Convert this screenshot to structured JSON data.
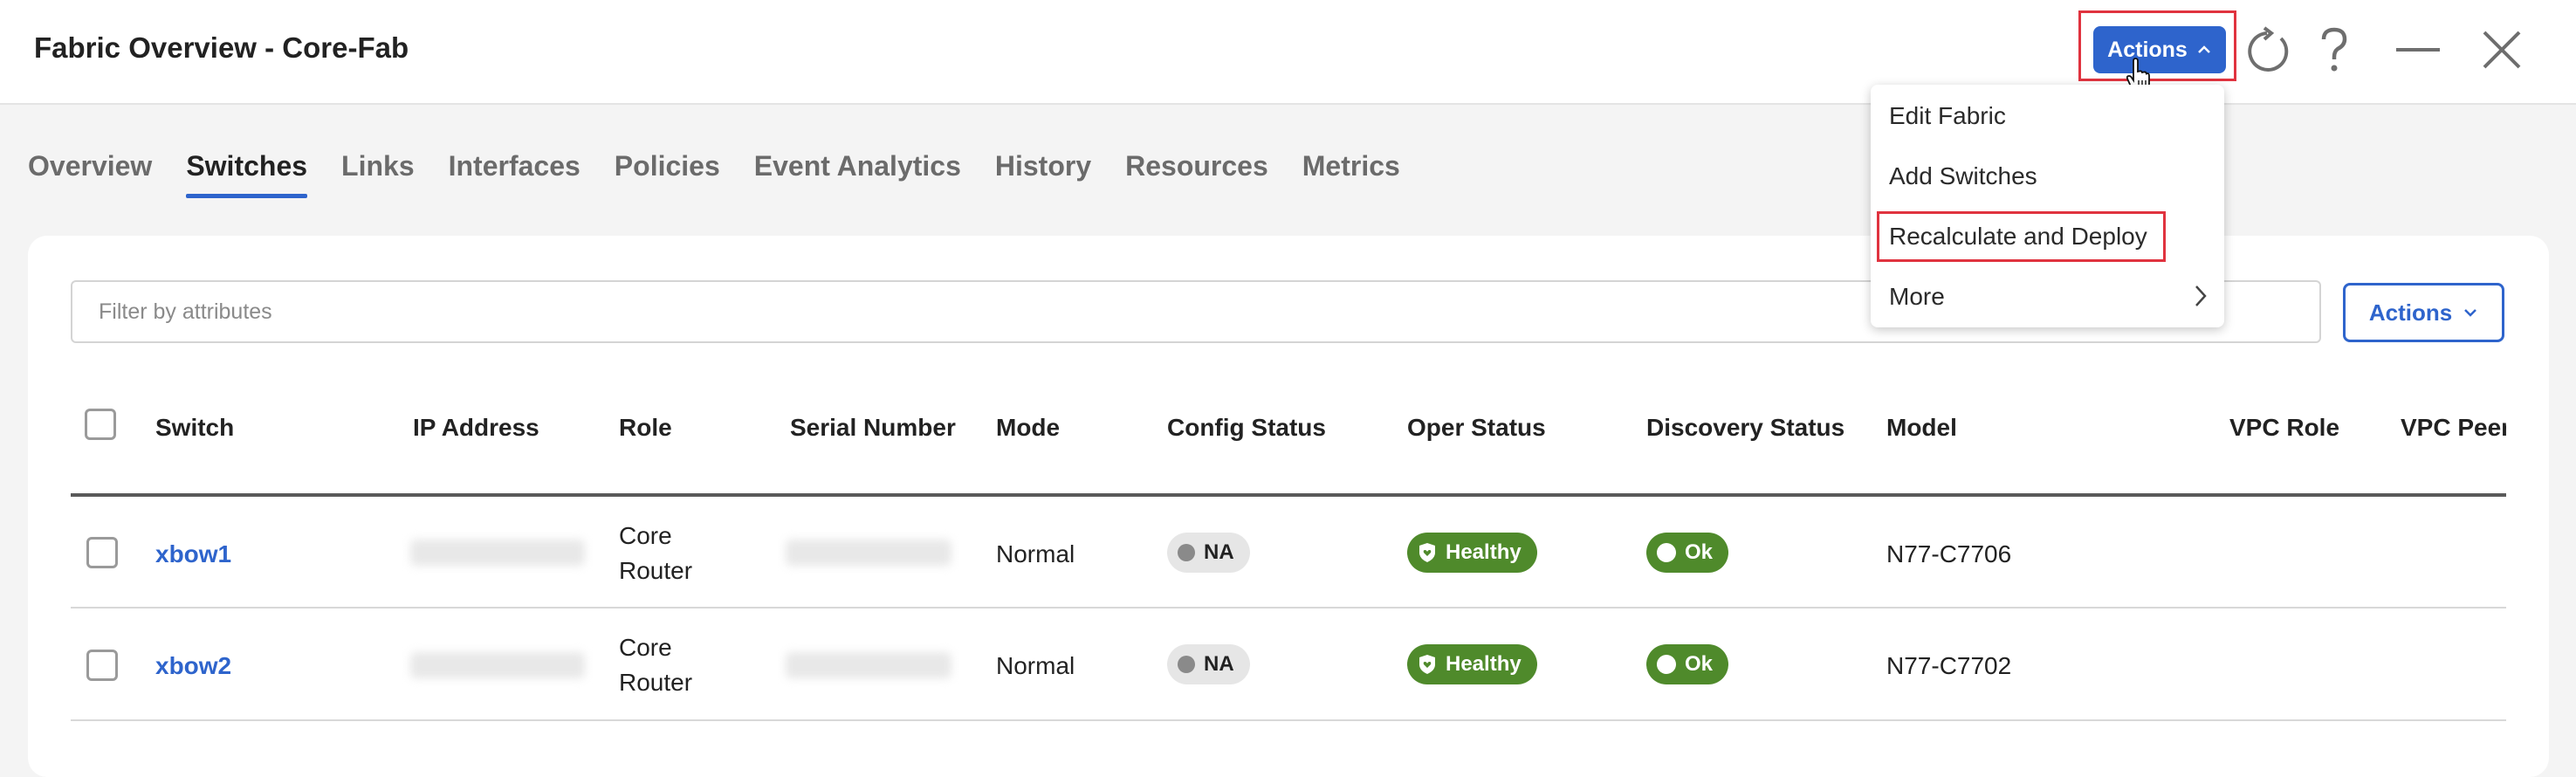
{
  "header": {
    "title": "Fabric Overview - Core-Fab",
    "actions_label": "Actions"
  },
  "actions_menu": {
    "items": [
      {
        "label": "Edit Fabric"
      },
      {
        "label": "Add Switches"
      },
      {
        "label": "Recalculate and Deploy",
        "highlighted": true
      },
      {
        "label": "More",
        "has_submenu": true
      }
    ]
  },
  "tabs": [
    {
      "label": "Overview"
    },
    {
      "label": "Switches",
      "active": true
    },
    {
      "label": "Links"
    },
    {
      "label": "Interfaces"
    },
    {
      "label": "Policies"
    },
    {
      "label": "Event Analytics"
    },
    {
      "label": "History"
    },
    {
      "label": "Resources"
    },
    {
      "label": "Metrics"
    }
  ],
  "toolbar": {
    "filter_placeholder": "Filter by attributes",
    "actions_label": "Actions"
  },
  "table": {
    "columns": [
      "Switch",
      "IP Address",
      "Role",
      "Serial Number",
      "Mode",
      "Config Status",
      "Oper Status",
      "Discovery Status",
      "Model",
      "VPC Role",
      "VPC Peer"
    ],
    "rows": [
      {
        "switch": "xbow1",
        "role_line1": "Core",
        "role_line2": "Router",
        "mode": "Normal",
        "config_status": "NA",
        "oper_status": "Healthy",
        "discovery_status": "Ok",
        "model": "N77-C7706"
      },
      {
        "switch": "xbow2",
        "role_line1": "Core",
        "role_line2": "Router",
        "mode": "Normal",
        "config_status": "NA",
        "oper_status": "Healthy",
        "discovery_status": "Ok",
        "model": "N77-C7702"
      }
    ]
  },
  "colors": {
    "accent": "#2e64cc",
    "healthy": "#4f8a2b",
    "highlight": "#e0333f"
  }
}
